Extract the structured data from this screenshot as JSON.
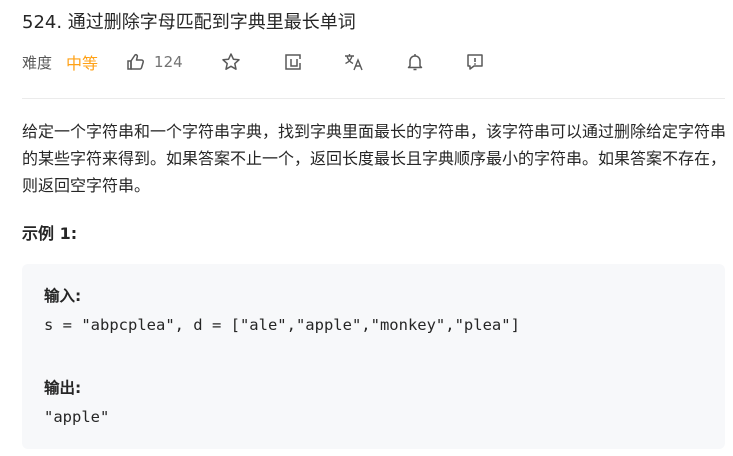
{
  "problem": {
    "title": "524. 通过删除字母匹配到字典里最长单词",
    "difficulty_label": "难度",
    "difficulty_value": "中等",
    "like_count": "124"
  },
  "icons": {
    "like": "thumbs-up-icon",
    "favorite": "star-icon",
    "share": "share-icon",
    "translate": "translate-icon",
    "notify": "bell-icon",
    "feedback": "feedback-icon"
  },
  "description": {
    "text": "给定一个字符串和一个字符串字典，找到字典里面最长的字符串，该字符串可以通过删除给定字符串的某些字符来得到。如果答案不止一个，返回长度最长且字典顺序最小的字符串。如果答案不存在，则返回空字符串。"
  },
  "example": {
    "title": "示例 1:",
    "input_label": "输入:",
    "input_value": "s = \"abpcplea\", d = [\"ale\",\"apple\",\"monkey\",\"plea\"]",
    "output_label": "输出:",
    "output_value": "\"apple\""
  },
  "colors": {
    "difficulty_medium": "#ffa116",
    "code_background": "#f7f8fa",
    "divider": "#ebebeb"
  }
}
